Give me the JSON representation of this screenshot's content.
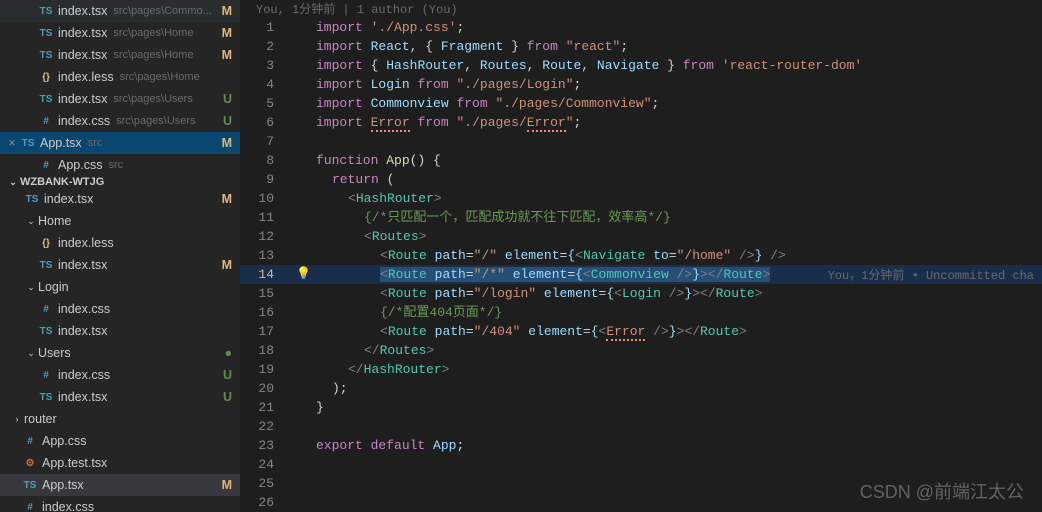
{
  "openEditors": [
    {
      "icon": "TS",
      "iconCls": "ts",
      "name": "index.tsx",
      "path": "src\\pages\\Commo...",
      "status": "M",
      "statusCls": "m",
      "pad": 38,
      "close": false
    },
    {
      "icon": "TS",
      "iconCls": "ts",
      "name": "index.tsx",
      "path": "src\\pages\\Home",
      "status": "M",
      "statusCls": "m",
      "pad": 38,
      "close": false
    },
    {
      "icon": "TS",
      "iconCls": "ts",
      "name": "index.tsx",
      "path": "src\\pages\\Home",
      "status": "M",
      "statusCls": "m",
      "pad": 38,
      "close": false
    },
    {
      "icon": "{}",
      "iconCls": "less",
      "name": "index.less",
      "path": "src\\pages\\Home",
      "status": "",
      "statusCls": "",
      "pad": 38,
      "close": false
    },
    {
      "icon": "TS",
      "iconCls": "ts",
      "name": "index.tsx",
      "path": "src\\pages\\Users",
      "status": "U",
      "statusCls": "u",
      "pad": 38,
      "close": false
    },
    {
      "icon": "#",
      "iconCls": "css",
      "name": "index.css",
      "path": "src\\pages\\Users",
      "status": "U",
      "statusCls": "u",
      "pad": 38,
      "close": false
    },
    {
      "icon": "TS",
      "iconCls": "ts",
      "name": "App.tsx",
      "path": "src",
      "status": "M",
      "statusCls": "m",
      "pad": 20,
      "close": true,
      "active": true
    },
    {
      "icon": "#",
      "iconCls": "css",
      "name": "App.css",
      "path": "src",
      "status": "",
      "statusCls": "",
      "pad": 38,
      "close": false
    }
  ],
  "section": "WZBANK-WTJG",
  "tree": [
    {
      "type": "file",
      "chev": false,
      "pad": 24,
      "icon": "TS",
      "iconCls": "ts",
      "name": "index.tsx",
      "status": "M",
      "statusCls": "m"
    },
    {
      "type": "dir",
      "chev": "v",
      "pad": 24,
      "name": "Home"
    },
    {
      "type": "file",
      "chev": false,
      "pad": 38,
      "icon": "{}",
      "iconCls": "less",
      "name": "index.less"
    },
    {
      "type": "file",
      "chev": false,
      "pad": 38,
      "icon": "TS",
      "iconCls": "ts",
      "name": "index.tsx",
      "status": "M",
      "statusCls": "m"
    },
    {
      "type": "dir",
      "chev": "v",
      "pad": 24,
      "name": "Login"
    },
    {
      "type": "file",
      "chev": false,
      "pad": 38,
      "icon": "#",
      "iconCls": "css",
      "name": "index.css"
    },
    {
      "type": "file",
      "chev": false,
      "pad": 38,
      "icon": "TS",
      "iconCls": "ts",
      "name": "index.tsx"
    },
    {
      "type": "dir",
      "chev": "v",
      "pad": 24,
      "name": "Users",
      "status": "●",
      "statusCls": "dot"
    },
    {
      "type": "file",
      "chev": false,
      "pad": 38,
      "icon": "#",
      "iconCls": "css",
      "name": "index.css",
      "status": "U",
      "statusCls": "u"
    },
    {
      "type": "file",
      "chev": false,
      "pad": 38,
      "icon": "TS",
      "iconCls": "ts",
      "name": "index.tsx",
      "status": "U",
      "statusCls": "u"
    },
    {
      "type": "dir",
      "chev": ">",
      "pad": 10,
      "name": "router"
    },
    {
      "type": "file",
      "chev": false,
      "pad": 22,
      "icon": "#",
      "iconCls": "css",
      "name": "App.css"
    },
    {
      "type": "file",
      "chev": false,
      "pad": 22,
      "icon": "⚙",
      "iconCls": "test",
      "name": "App.test.tsx"
    },
    {
      "type": "file",
      "chev": false,
      "pad": 22,
      "icon": "TS",
      "iconCls": "ts",
      "name": "App.tsx",
      "status": "M",
      "statusCls": "m",
      "sel": true
    },
    {
      "type": "file",
      "chev": false,
      "pad": 22,
      "icon": "#",
      "iconCls": "css",
      "name": "index.css"
    }
  ],
  "blame": "You, 1分钟前 | 1 author (You)",
  "lens": "You，1分钟前 • Uncommitted cha",
  "watermark": "CSDN @前端江太公",
  "code": {
    "l1_kw": "import",
    "l1_str": "'./App.css'",
    "l2_kw": "import",
    "l2_a": "React",
    "l2_b": "Fragment",
    "l2_from": "from",
    "l2_str": "\"react\"",
    "l3_kw": "import",
    "l3_a": "HashRouter",
    "l3_b": "Routes",
    "l3_c": "Route",
    "l3_d": "Navigate",
    "l3_from": "from",
    "l3_str": "'react-router-dom'",
    "l4_kw": "import",
    "l4_a": "Login",
    "l4_from": "from",
    "l4_str": "\"./pages/Login\"",
    "l5_kw": "import",
    "l5_a": "Commonview",
    "l5_from": "from",
    "l5_str": "\"./pages/Commonview\"",
    "l6_kw": "import",
    "l6_a": "Error",
    "l6_from": "from",
    "l6_s1": "\"./pages/",
    "l6_s2": "Error",
    "l6_s3": "\"",
    "l8_kw": "function",
    "l8_fn": "App",
    "l9_kw": "return",
    "l10": "HashRouter",
    "l11": "{/*只匹配一个，匹配成功就不往下匹配，效率高*/}",
    "l12": "Routes",
    "l13_a": "Route",
    "l13_p": "path",
    "l13_pv": "\"/\"",
    "l13_e": "element",
    "l13_nav": "Navigate",
    "l13_to": "to",
    "l13_tov": "\"/home\"",
    "l14_a": "Route",
    "l14_p": "path",
    "l14_pv": "\"/*\"",
    "l14_e": "element",
    "l14_el": "Commonview",
    "l15_a": "Route",
    "l15_p": "path",
    "l15_pv": "\"/login\"",
    "l15_e": "element",
    "l15_el": "Login",
    "l16": "{/*配置404页面*/}",
    "l17_a": "Route",
    "l17_p": "path",
    "l17_pv": "\"/404\"",
    "l17_e": "element",
    "l17_el": "Error",
    "l23_a": "export",
    "l23_b": "default",
    "l23_c": "App"
  }
}
